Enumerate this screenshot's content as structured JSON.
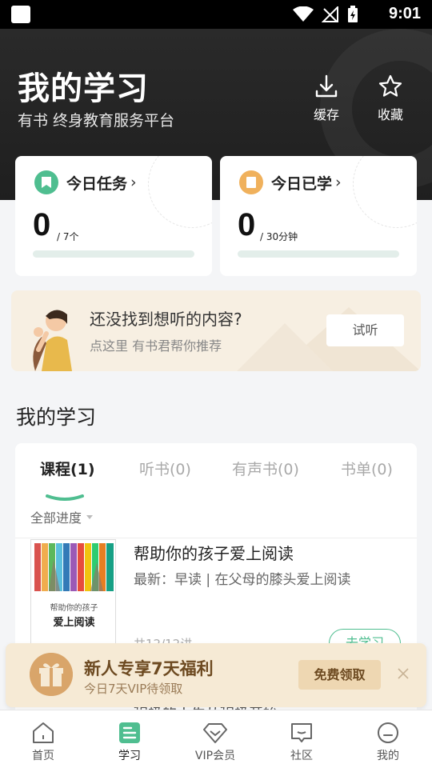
{
  "status_bar": {
    "time": "9:01"
  },
  "header": {
    "title": "我的学习",
    "subtitle": "有书 终身教育服务平台",
    "cache_label": "缓存",
    "favorite_label": "收藏"
  },
  "tasks": {
    "today_task": {
      "title": "今日任务",
      "arrow": "›",
      "value": "0",
      "unit": "/ 7个"
    },
    "today_learned": {
      "title": "今日已学",
      "arrow": "›",
      "value": "0",
      "unit": "/ 30分钟"
    }
  },
  "promo": {
    "title": "还没找到想听的内容?",
    "subtitle": "点这里 有书君帮你推荐",
    "button": "试听"
  },
  "my_study": {
    "title": "我的学习",
    "tabs": [
      {
        "label": "课程(1)"
      },
      {
        "label": "听书(0)"
      },
      {
        "label": "有声书(0)"
      },
      {
        "label": "书单(0)"
      }
    ],
    "filter": "全部进度",
    "items": [
      {
        "cover_title_small": "帮助你的孩子",
        "cover_title_big": "爱上阅读",
        "name": "帮助你的孩子爱上阅读",
        "latest": "最新：早读 | 在父母的膝头爱上阅读",
        "count": "共12/12讲",
        "button": "去学习"
      },
      {
        "name": "积极的人生从积极开始"
      }
    ]
  },
  "gift_banner": {
    "title": "新人专享7天福利",
    "subtitle": "今日7天VIP待领取",
    "button": "免费领取"
  },
  "tabbar": [
    {
      "label": "首页",
      "icon": "home-icon"
    },
    {
      "label": "学习",
      "icon": "study-icon"
    },
    {
      "label": "VIP会员",
      "icon": "diamond-icon"
    },
    {
      "label": "社区",
      "icon": "community-icon"
    },
    {
      "label": "我的",
      "icon": "profile-icon"
    }
  ],
  "colors": {
    "accent": "#4fbe90",
    "orange": "#f0b15c",
    "gold": "#6d4a21"
  }
}
